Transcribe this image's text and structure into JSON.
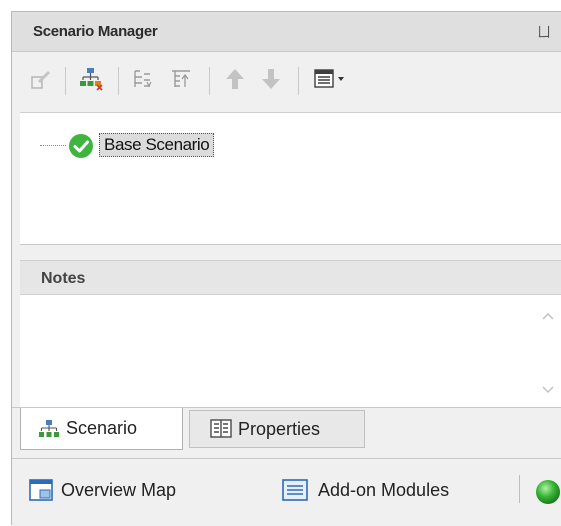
{
  "panel": {
    "title": "Scenario Manager",
    "pin_glyph": "ㄩ"
  },
  "toolbar": {
    "buttons": [
      {
        "name": "edit-scenario-icon",
        "enabled": false
      },
      {
        "name": "new-child-scenario-icon",
        "enabled": true
      },
      {
        "name": "expand-all-icon",
        "enabled": false
      },
      {
        "name": "collapse-all-icon",
        "enabled": false
      },
      {
        "name": "move-up-icon",
        "enabled": false
      },
      {
        "name": "move-down-icon",
        "enabled": false
      },
      {
        "name": "view-options-icon",
        "enabled": true
      }
    ]
  },
  "tree": {
    "items": [
      {
        "label": "Base Scenario",
        "status": "ok",
        "status_color": "#3fb43f"
      }
    ]
  },
  "notes": {
    "title": "Notes",
    "value": ""
  },
  "tabs": [
    {
      "label": "Scenario",
      "active": true
    },
    {
      "label": "Properties",
      "active": false
    }
  ],
  "bottom_bar": {
    "items": [
      {
        "label": "Overview Map"
      },
      {
        "label": "Add-on Modules"
      }
    ],
    "status_color": "#34b534"
  }
}
